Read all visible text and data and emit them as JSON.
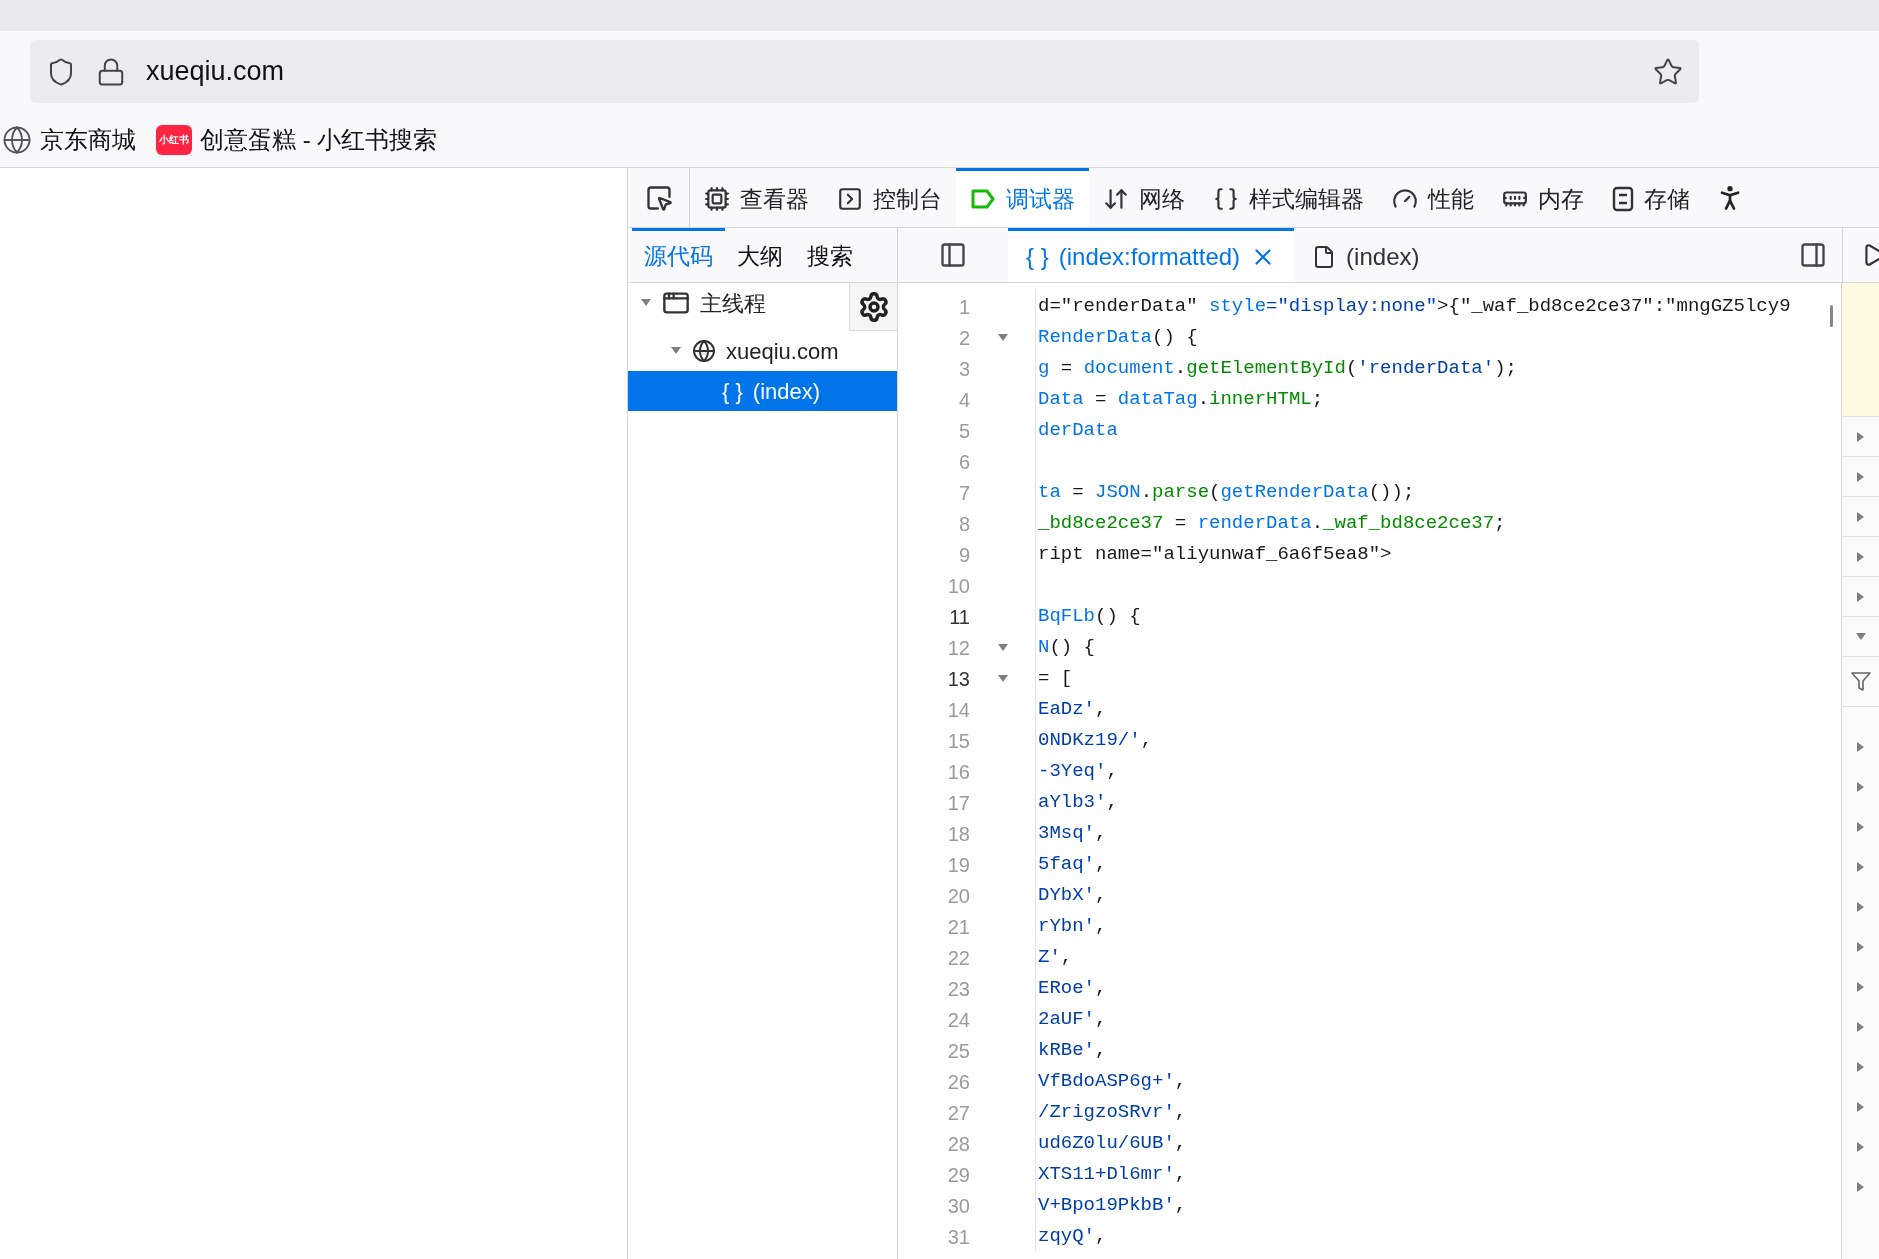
{
  "browser": {
    "address": "xueqiu.com",
    "bookmarks": [
      {
        "kind": "globe",
        "label": "京东商城"
      },
      {
        "kind": "badge",
        "badge": "小红书",
        "label": "创意蛋糕 - 小红书搜索"
      }
    ]
  },
  "devtools": {
    "tools": [
      {
        "kind": "inspector",
        "label": "查看器",
        "selected": false
      },
      {
        "kind": "console",
        "label": "控制台",
        "selected": false
      },
      {
        "kind": "debugger",
        "label": "调试器",
        "selected": true
      },
      {
        "kind": "network",
        "label": "网络",
        "selected": false
      },
      {
        "kind": "style",
        "label": "样式编辑器",
        "selected": false
      },
      {
        "kind": "performance",
        "label": "性能",
        "selected": false
      },
      {
        "kind": "memory",
        "label": "内存",
        "selected": false
      },
      {
        "kind": "storage",
        "label": "存储",
        "selected": false
      }
    ],
    "source_tabs": [
      {
        "label": "源代码",
        "selected": true
      },
      {
        "label": "大纲",
        "selected": false
      },
      {
        "label": "搜索",
        "selected": false
      }
    ],
    "editor_tabs": [
      {
        "kind": "formatted",
        "glyph": "{ }",
        "label": "(index:formatted)",
        "selected": true,
        "closable": true
      },
      {
        "kind": "file",
        "label": "(index)",
        "selected": false,
        "closable": false
      }
    ],
    "tree": [
      {
        "kind": "thread",
        "label": "主线程",
        "expanded": true,
        "selected": false,
        "children": [
          {
            "kind": "domain",
            "label": "xueqiu.com",
            "expanded": true,
            "selected": false,
            "children": [
              {
                "kind": "source",
                "glyph": "{ }",
                "label": "(index)",
                "selected": true
              }
            ]
          }
        ]
      }
    ],
    "lines": [
      {
        "number": "1",
        "active": false,
        "fold": false,
        "tokens": [
          {
            "kind": "plain",
            "text": "d=\"renderData\" "
          },
          {
            "kind": "name",
            "text": "style"
          },
          {
            "kind": "string",
            "text": "=\"display:none\""
          },
          {
            "kind": "plain",
            "text": ">{\"_waf_bd8ce2ce37\":\"mngGZ5lcy9"
          }
        ]
      },
      {
        "number": "2",
        "active": false,
        "fold": true,
        "tokens": [
          {
            "kind": "name",
            "text": "RenderData"
          },
          {
            "kind": "plain",
            "text": "() {"
          }
        ]
      },
      {
        "number": "3",
        "active": false,
        "fold": false,
        "tokens": [
          {
            "kind": "name",
            "text": "g"
          },
          {
            "kind": "plain",
            "text": " = "
          },
          {
            "kind": "name",
            "text": "document"
          },
          {
            "kind": "plain",
            "text": "."
          },
          {
            "kind": "method",
            "text": "getElementById"
          },
          {
            "kind": "plain",
            "text": "("
          },
          {
            "kind": "string",
            "text": "'renderData'"
          },
          {
            "kind": "plain",
            "text": ");"
          }
        ]
      },
      {
        "number": "4",
        "active": false,
        "fold": false,
        "tokens": [
          {
            "kind": "name",
            "text": "Data"
          },
          {
            "kind": "plain",
            "text": " = "
          },
          {
            "kind": "name",
            "text": "dataTag"
          },
          {
            "kind": "plain",
            "text": "."
          },
          {
            "kind": "method",
            "text": "innerHTML"
          },
          {
            "kind": "plain",
            "text": ";"
          }
        ]
      },
      {
        "number": "5",
        "active": false,
        "fold": false,
        "tokens": [
          {
            "kind": "name",
            "text": "derData"
          }
        ]
      },
      {
        "number": "6",
        "active": false,
        "fold": false
      },
      {
        "number": "7",
        "active": false,
        "fold": false,
        "tokens": [
          {
            "kind": "name",
            "text": "ta"
          },
          {
            "kind": "plain",
            "text": " = "
          },
          {
            "kind": "name",
            "text": "JSON"
          },
          {
            "kind": "plain",
            "text": "."
          },
          {
            "kind": "method",
            "text": "parse"
          },
          {
            "kind": "plain",
            "text": "("
          },
          {
            "kind": "name",
            "text": "getRenderData"
          },
          {
            "kind": "plain",
            "text": "());"
          }
        ]
      },
      {
        "number": "8",
        "active": false,
        "fold": false,
        "tokens": [
          {
            "kind": "method",
            "text": "_bd8ce2ce37"
          },
          {
            "kind": "plain",
            "text": " = "
          },
          {
            "kind": "name",
            "text": "renderData"
          },
          {
            "kind": "plain",
            "text": "."
          },
          {
            "kind": "method",
            "text": "_waf_bd8ce2ce37"
          },
          {
            "kind": "plain",
            "text": ";"
          }
        ]
      },
      {
        "number": "9",
        "active": false,
        "fold": false,
        "tokens": [
          {
            "kind": "plain",
            "text": "ript name=\"aliyunwaf_6a6f5ea8\">"
          }
        ]
      },
      {
        "number": "10",
        "active": false,
        "fold": false
      },
      {
        "number": "11",
        "active": true,
        "fold": false,
        "tokens": [
          {
            "kind": "name",
            "text": "BqFLb"
          },
          {
            "kind": "plain",
            "text": "() {"
          }
        ]
      },
      {
        "number": "12",
        "active": false,
        "fold": true,
        "tokens": [
          {
            "kind": "name",
            "text": "N"
          },
          {
            "kind": "plain",
            "text": "() {"
          }
        ]
      },
      {
        "number": "13",
        "active": true,
        "fold": true,
        "tokens": [
          {
            "kind": "plain",
            "text": "= ["
          }
        ]
      },
      {
        "number": "14",
        "active": false,
        "fold": false,
        "tokens": [
          {
            "kind": "string",
            "text": "EaDz'"
          },
          {
            "kind": "plain",
            "text": ","
          }
        ]
      },
      {
        "number": "15",
        "active": false,
        "fold": false,
        "tokens": [
          {
            "kind": "string",
            "text": "0NDKz19/'"
          },
          {
            "kind": "plain",
            "text": ","
          }
        ]
      },
      {
        "number": "16",
        "active": false,
        "fold": false,
        "tokens": [
          {
            "kind": "string",
            "text": "-3Yeq'"
          },
          {
            "kind": "plain",
            "text": ","
          }
        ]
      },
      {
        "number": "17",
        "active": false,
        "fold": false,
        "tokens": [
          {
            "kind": "string",
            "text": "aYlb3'"
          },
          {
            "kind": "plain",
            "text": ","
          }
        ]
      },
      {
        "number": "18",
        "active": false,
        "fold": false,
        "tokens": [
          {
            "kind": "string",
            "text": "3Msq'"
          },
          {
            "kind": "plain",
            "text": ","
          }
        ]
      },
      {
        "number": "19",
        "active": false,
        "fold": false,
        "tokens": [
          {
            "kind": "string",
            "text": "5faq'"
          },
          {
            "kind": "plain",
            "text": ","
          }
        ]
      },
      {
        "number": "20",
        "active": false,
        "fold": false,
        "tokens": [
          {
            "kind": "string",
            "text": "DYbX'"
          },
          {
            "kind": "plain",
            "text": ","
          }
        ]
      },
      {
        "number": "21",
        "active": false,
        "fold": false,
        "tokens": [
          {
            "kind": "string",
            "text": "rYbn'"
          },
          {
            "kind": "plain",
            "text": ","
          }
        ]
      },
      {
        "number": "22",
        "active": false,
        "fold": false,
        "tokens": [
          {
            "kind": "string",
            "text": "Z'"
          },
          {
            "kind": "plain",
            "text": ","
          }
        ]
      },
      {
        "number": "23",
        "active": false,
        "fold": false,
        "tokens": [
          {
            "kind": "string",
            "text": "ERoe'"
          },
          {
            "kind": "plain",
            "text": ","
          }
        ]
      },
      {
        "number": "24",
        "active": false,
        "fold": false,
        "tokens": [
          {
            "kind": "string",
            "text": "2aUF'"
          },
          {
            "kind": "plain",
            "text": ","
          }
        ]
      },
      {
        "number": "25",
        "active": false,
        "fold": false,
        "tokens": [
          {
            "kind": "string",
            "text": "kRBe'"
          },
          {
            "kind": "plain",
            "text": ","
          }
        ]
      },
      {
        "number": "26",
        "active": false,
        "fold": false,
        "tokens": [
          {
            "kind": "string",
            "text": "VfBdoASP6g+'"
          },
          {
            "kind": "plain",
            "text": ","
          }
        ]
      },
      {
        "number": "27",
        "active": false,
        "fold": false,
        "tokens": [
          {
            "kind": "string",
            "text": "/ZrigzoSRvr'"
          },
          {
            "kind": "plain",
            "text": ","
          }
        ]
      },
      {
        "number": "28",
        "active": false,
        "fold": false,
        "tokens": [
          {
            "kind": "string",
            "text": "ud6Z0lu/6UB'"
          },
          {
            "kind": "plain",
            "text": ","
          }
        ]
      },
      {
        "number": "29",
        "active": false,
        "fold": false,
        "tokens": [
          {
            "kind": "string",
            "text": "XTS11+Dl6mr'"
          },
          {
            "kind": "plain",
            "text": ","
          }
        ]
      },
      {
        "number": "30",
        "active": false,
        "fold": false,
        "tokens": [
          {
            "kind": "string",
            "text": "V+Bpo19PkbB'"
          },
          {
            "kind": "plain",
            "text": ","
          }
        ]
      },
      {
        "number": "31",
        "active": false,
        "fold": false,
        "tokens": [
          {
            "kind": "string",
            "text": "zqyQ'"
          },
          {
            "kind": "plain",
            "text": ","
          }
        ]
      }
    ]
  }
}
